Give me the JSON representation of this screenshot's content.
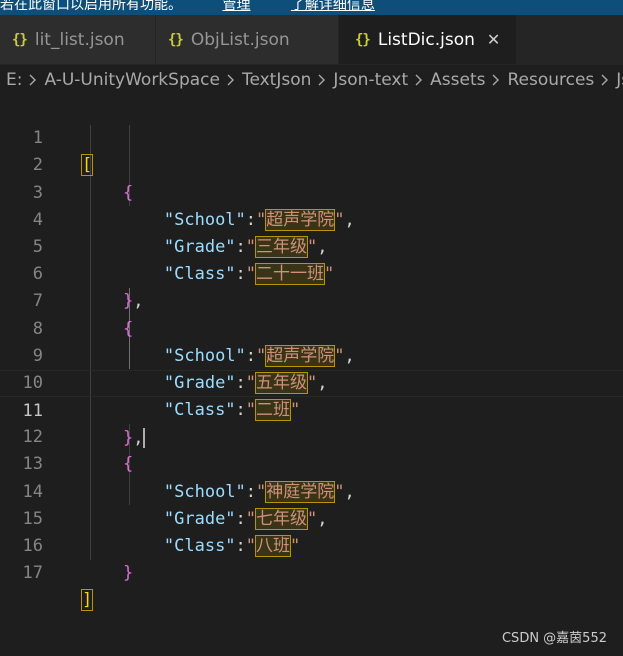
{
  "notice": {
    "text": "若在此窗口以启用所有功能。",
    "link1": "管理",
    "link2": "了解详细信息"
  },
  "tabs": [
    {
      "icon": "{}",
      "label": "lit_list.json",
      "active": false
    },
    {
      "icon": "{}",
      "label": "ObjList.json",
      "active": false
    },
    {
      "icon": "{}",
      "label": "ListDic.json",
      "active": true,
      "close": "✕"
    }
  ],
  "breadcrumb": [
    "E:",
    "A-U-UnityWorkSpace",
    "TextJson",
    "Json-text",
    "Assets",
    "Resources",
    "Js"
  ],
  "editor": {
    "line_numbers": [
      "1",
      "2",
      "3",
      "4",
      "5",
      "6",
      "7",
      "8",
      "9",
      "10",
      "11",
      "12",
      "13",
      "14",
      "15",
      "16",
      "17"
    ],
    "current_line": 11,
    "records": [
      {
        "school": "超声学院",
        "grade": "三年级",
        "class": "二十一班"
      },
      {
        "school": "超声学院",
        "grade": "五年级",
        "class": "二班"
      },
      {
        "school": "神庭学院",
        "grade": "七年级",
        "class": "八班"
      }
    ],
    "keys": {
      "school": "\"School\"",
      "grade": "\"Grade\"",
      "class": "\"Class\""
    }
  },
  "watermark": "CSDN @嘉茵552",
  "colors": {
    "bracket_level1": "#ffd700",
    "bracket_level2": "#da70d6",
    "json_key": "#9cdcfe",
    "json_string": "#ce9178",
    "notice_bg": "#0d4f7a"
  }
}
